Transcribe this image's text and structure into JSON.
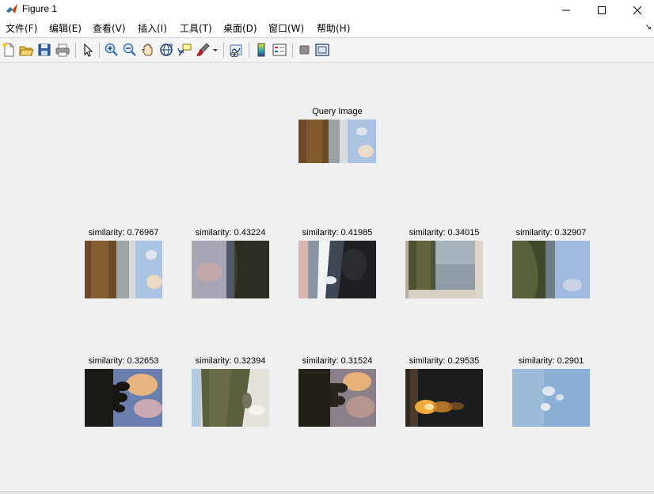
{
  "window": {
    "title": "Figure 1",
    "minimize_icon": "minimize-icon",
    "maximize_icon": "maximize-icon",
    "close_icon": "close-icon"
  },
  "menu": {
    "items": [
      "文件(F)",
      "编辑(E)",
      "查看(V)",
      "插入(I)",
      "工具(T)",
      "桌面(D)",
      "窗口(W)",
      "帮助(H)"
    ],
    "overflow_icon": "dock-arrow-icon"
  },
  "toolbar": {
    "icons": [
      "new-figure-icon",
      "open-file-icon",
      "save-icon",
      "print-icon",
      "edit-plot-arrow-icon",
      "zoom-in-icon",
      "zoom-out-icon",
      "pan-hand-icon",
      "rotate-3d-icon",
      "data-cursor-icon",
      "brush-icon",
      "link-plot-icon",
      "colorbar-icon",
      "legend-icon",
      "hide-plot-tools-icon",
      "show-plot-tools-icon"
    ]
  },
  "query": {
    "title": "Query Image",
    "scene": "rocky shore with sky"
  },
  "results": [
    {
      "title": "similarity: 0.76967",
      "scene": "rocky shore with sky"
    },
    {
      "title": "similarity: 0.43224",
      "scene": "cloudy sea and dark cliff"
    },
    {
      "title": "similarity: 0.41985",
      "scene": "dark rocks with waves"
    },
    {
      "title": "similarity: 0.34015",
      "scene": "cliff and sea through frame"
    },
    {
      "title": "similarity: 0.32907",
      "scene": "green hillside and sky"
    },
    {
      "title": "similarity: 0.32653",
      "scene": "rock stack silhouette at sunset"
    },
    {
      "title": "similarity: 0.32394",
      "scene": "grassy slope and sand"
    },
    {
      "title": "similarity: 0.31524",
      "scene": "rock stack at dusk"
    },
    {
      "title": "similarity: 0.29535",
      "scene": "sunset reflection on water"
    },
    {
      "title": "similarity: 0.2901",
      "scene": "blue sky with clouds"
    }
  ],
  "colors": {
    "window_bg": "#f0f0f0",
    "titlebar_bg": "#ffffff",
    "text": "#000000"
  }
}
